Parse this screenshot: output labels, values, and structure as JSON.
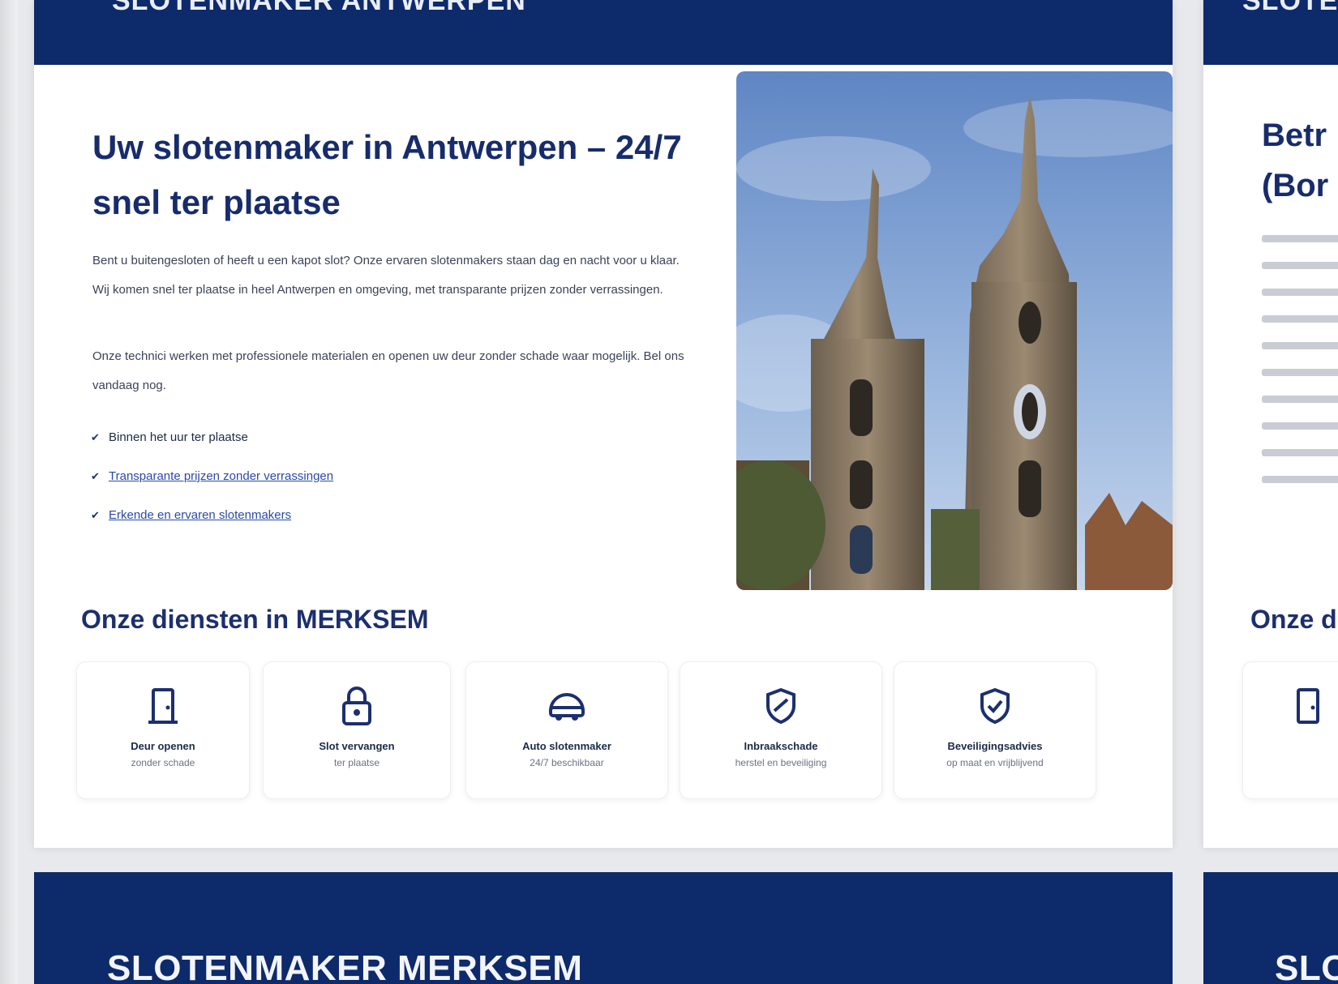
{
  "main_panel": {
    "header_text": "SLOTENMAKER ANTWERPEN",
    "hero_title": "Uw slotenmaker in Antwerpen – 24/7 snel ter plaatse",
    "paragraphs": [
      "Bent u buitengesloten of heeft u een kapot slot? Onze ervaren slotenmakers staan dag en nacht voor u klaar. Wij komen snel ter plaatse in heel Antwerpen en omgeving, met transparante prijzen zonder verrassingen.",
      "Onze technici werken met professionele materialen en openen uw deur zonder schade waar mogelijk. Bel ons vandaag nog."
    ],
    "checklist": [
      {
        "text": "Binnen het uur ter plaatse",
        "linked": false
      },
      {
        "text": "Transparante prijzen zonder verrassingen",
        "linked": true
      },
      {
        "text": "Erkende en ervaren slotenmakers",
        "linked": true
      }
    ],
    "services_title": "Onze diensten in MERKSEM",
    "services": [
      {
        "icon": "door-icon",
        "title": "Deur openen",
        "sub": "zonder schade"
      },
      {
        "icon": "padlock-icon",
        "title": "Slot vervangen",
        "sub": "ter plaatse"
      },
      {
        "icon": "car-icon",
        "title": "Auto slotenmaker",
        "sub": "24/7 beschikbaar"
      },
      {
        "icon": "shield-icon",
        "title": "Inbraakschade",
        "sub": "herstel en beveiliging"
      },
      {
        "icon": "shield-check-icon",
        "title": "Beveiligingsadvies",
        "sub": "op maat en vrijblijvend"
      }
    ],
    "bottom_text": "SLOTENMAKER MERKSEM"
  },
  "side_panel": {
    "header_text": "SLOTENMAKER",
    "title": "Betr\n(Bor",
    "services_title": "Onze d",
    "bottom_text": "SLO"
  },
  "colors": {
    "navy": "#0d2a6b",
    "title_blue": "#172c6b",
    "link_blue": "#2a49a8",
    "background": "#e8e9ec"
  }
}
